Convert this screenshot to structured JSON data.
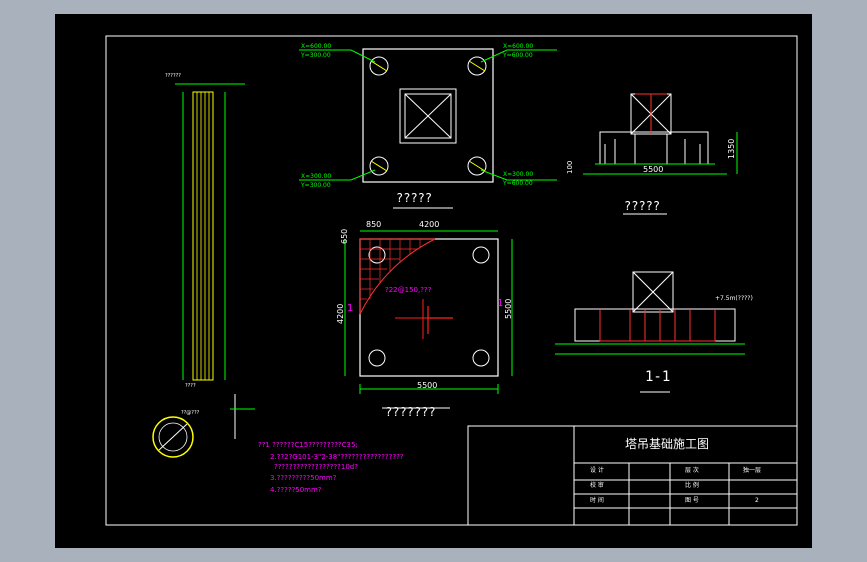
{
  "title_block": {
    "drawing_title": "塔吊基础施工图",
    "row1": [
      "设 计",
      "",
      "层 次",
      "独一层"
    ],
    "row2": [
      "校 审",
      "",
      "比 例",
      ""
    ],
    "row3": [
      "时 间",
      "",
      "图 号",
      "2"
    ]
  },
  "captions": {
    "plan_top": "?????",
    "elev_top_right": "?????",
    "plan_bottom": "???????",
    "section": "1-1"
  },
  "dims": {
    "d4200_top": "4200",
    "d850": "850",
    "d650": "650",
    "d4200_left": "4200",
    "d5500_right": "5500",
    "d5500_bottom": "5500",
    "d5500_elev": "5500",
    "d1350": "1350",
    "d100": "100",
    "grid_note": "?22@150,???",
    "section_mark": "1",
    "elev_note": "+7.5m(????)"
  },
  "coords": {
    "tl_x": "X=600.00",
    "tl_y": "Y=300.00",
    "tr_x": "X=600.00",
    "tr_y": "Y=600.00",
    "bl_x": "X=300.00",
    "bl_y": "Y=300.00",
    "br_x": "X=300.00",
    "br_y": "Y=600.00"
  },
  "notes": [
    "??1 ??????C15?????????C35;",
    "2.??2?G101-3\"2-38\"?????????????????",
    "??????????????????10d?",
    "3.?????????50mm?",
    "4.?????50mm?"
  ],
  "pile": {
    "top_label": "??????",
    "circle_label": "??@???",
    "section_label": "????"
  }
}
